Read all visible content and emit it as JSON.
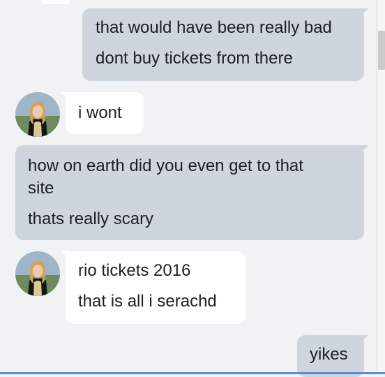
{
  "messages": [
    {
      "direction": "sent",
      "lines": [
        "that would have been really bad",
        "dont buy tickets from there"
      ]
    },
    {
      "direction": "received",
      "lines": [
        "i wont"
      ]
    },
    {
      "direction": "sent",
      "lines": [
        "how on earth did you even get to that",
        "site",
        "thats really scary"
      ]
    },
    {
      "direction": "received",
      "lines": [
        "rio tickets 2016",
        "that is all i serachd"
      ]
    },
    {
      "direction": "sent",
      "lines": [
        "yikes"
      ]
    }
  ],
  "avatar_icon": "contact-photo",
  "colors": {
    "sent_bubble": "#ced5dc",
    "received_bubble": "#ffffff",
    "background": "#f1f2f4"
  }
}
